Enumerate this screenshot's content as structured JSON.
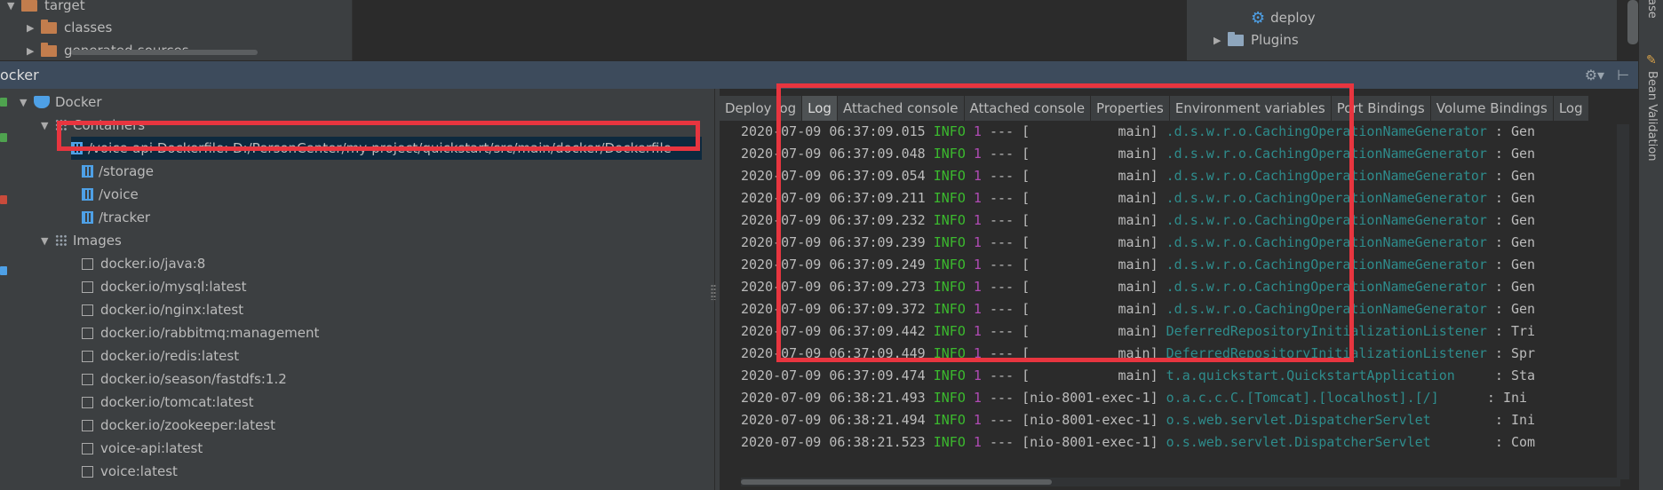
{
  "project_tree": {
    "items": [
      {
        "label": "target",
        "expanded": true
      },
      {
        "label": "classes",
        "expanded": false
      },
      {
        "label": "generated-sources",
        "expanded": false
      }
    ],
    "maven_items": [
      {
        "label": "deploy"
      },
      {
        "label": "Plugins"
      }
    ]
  },
  "panel": {
    "title": "ocker"
  },
  "docker_tree": {
    "root": "Docker",
    "containers_label": "Containers",
    "containers": [
      {
        "label": "/voice-api Dockerfile: D:/PersonCenter/my-project/quickstart/src/main/docker/Dockerfile"
      },
      {
        "label": "/storage"
      },
      {
        "label": "/voice"
      },
      {
        "label": "/tracker"
      }
    ],
    "images_label": "Images",
    "images": [
      {
        "label": "docker.io/java:8"
      },
      {
        "label": "docker.io/mysql:latest"
      },
      {
        "label": "docker.io/nginx:latest"
      },
      {
        "label": "docker.io/rabbitmq:management"
      },
      {
        "label": "docker.io/redis:latest"
      },
      {
        "label": "docker.io/season/fastdfs:1.2"
      },
      {
        "label": "docker.io/tomcat:latest"
      },
      {
        "label": "docker.io/zookeeper:latest"
      },
      {
        "label": "voice-api:latest"
      },
      {
        "label": "voice:latest"
      }
    ]
  },
  "tabs": [
    {
      "label": "Deploy log"
    },
    {
      "label": "Log"
    },
    {
      "label": "Attached console"
    },
    {
      "label": "Attached console"
    },
    {
      "label": "Properties"
    },
    {
      "label": "Environment variables"
    },
    {
      "label": "Port Bindings"
    },
    {
      "label": "Volume Bindings"
    },
    {
      "label": "Log"
    }
  ],
  "log": [
    {
      "ts": "2020-07-09 06:37:09.015",
      "level": "INFO",
      "pid": "1",
      "sep": "---",
      "thread": "[           main]",
      "logger": ".d.s.w.r.o.CachingOperationNameGenerator",
      "msg": ": Gen"
    },
    {
      "ts": "2020-07-09 06:37:09.048",
      "level": "INFO",
      "pid": "1",
      "sep": "---",
      "thread": "[           main]",
      "logger": ".d.s.w.r.o.CachingOperationNameGenerator",
      "msg": ": Gen"
    },
    {
      "ts": "2020-07-09 06:37:09.054",
      "level": "INFO",
      "pid": "1",
      "sep": "---",
      "thread": "[           main]",
      "logger": ".d.s.w.r.o.CachingOperationNameGenerator",
      "msg": ": Gen"
    },
    {
      "ts": "2020-07-09 06:37:09.211",
      "level": "INFO",
      "pid": "1",
      "sep": "---",
      "thread": "[           main]",
      "logger": ".d.s.w.r.o.CachingOperationNameGenerator",
      "msg": ": Gen"
    },
    {
      "ts": "2020-07-09 06:37:09.232",
      "level": "INFO",
      "pid": "1",
      "sep": "---",
      "thread": "[           main]",
      "logger": ".d.s.w.r.o.CachingOperationNameGenerator",
      "msg": ": Gen"
    },
    {
      "ts": "2020-07-09 06:37:09.239",
      "level": "INFO",
      "pid": "1",
      "sep": "---",
      "thread": "[           main]",
      "logger": ".d.s.w.r.o.CachingOperationNameGenerator",
      "msg": ": Gen"
    },
    {
      "ts": "2020-07-09 06:37:09.249",
      "level": "INFO",
      "pid": "1",
      "sep": "---",
      "thread": "[           main]",
      "logger": ".d.s.w.r.o.CachingOperationNameGenerator",
      "msg": ": Gen"
    },
    {
      "ts": "2020-07-09 06:37:09.273",
      "level": "INFO",
      "pid": "1",
      "sep": "---",
      "thread": "[           main]",
      "logger": ".d.s.w.r.o.CachingOperationNameGenerator",
      "msg": ": Gen"
    },
    {
      "ts": "2020-07-09 06:37:09.372",
      "level": "INFO",
      "pid": "1",
      "sep": "---",
      "thread": "[           main]",
      "logger": ".d.s.w.r.o.CachingOperationNameGenerator",
      "msg": ": Gen"
    },
    {
      "ts": "2020-07-09 06:37:09.442",
      "level": "INFO",
      "pid": "1",
      "sep": "---",
      "thread": "[           main]",
      "logger": "DeferredRepositoryInitializationListener",
      "msg": ": Tri"
    },
    {
      "ts": "2020-07-09 06:37:09.449",
      "level": "INFO",
      "pid": "1",
      "sep": "---",
      "thread": "[           main]",
      "logger": "DeferredRepositoryInitializationListener",
      "msg": ": Spr"
    },
    {
      "ts": "2020-07-09 06:37:09.474",
      "level": "INFO",
      "pid": "1",
      "sep": "---",
      "thread": "[           main]",
      "logger": "t.a.quickstart.QuickstartApplication    ",
      "msg": ": Sta"
    },
    {
      "ts": "2020-07-09 06:38:21.493",
      "level": "INFO",
      "pid": "1",
      "sep": "---",
      "thread": "[nio-8001-exec-1]",
      "logger": "o.a.c.c.C.[Tomcat].[localhost].[/]     ",
      "msg": ": Ini"
    },
    {
      "ts": "2020-07-09 06:38:21.494",
      "level": "INFO",
      "pid": "1",
      "sep": "---",
      "thread": "[nio-8001-exec-1]",
      "logger": "o.s.web.servlet.DispatcherServlet       ",
      "msg": ": Ini"
    },
    {
      "ts": "2020-07-09 06:38:21.523",
      "level": "INFO",
      "pid": "1",
      "sep": "---",
      "thread": "[nio-8001-exec-1]",
      "logger": "o.s.web.servlet.DispatcherServlet       ",
      "msg": ": Com"
    }
  ],
  "right_strip": {
    "top_label": "ase",
    "bean_validation": "Bean Validation"
  },
  "colors": {
    "highlight_box": "#e8353f",
    "info_level": "#3bba2e",
    "pid": "#b04bb4",
    "logger": "#2e8c8c",
    "selection": "#0d293e"
  }
}
